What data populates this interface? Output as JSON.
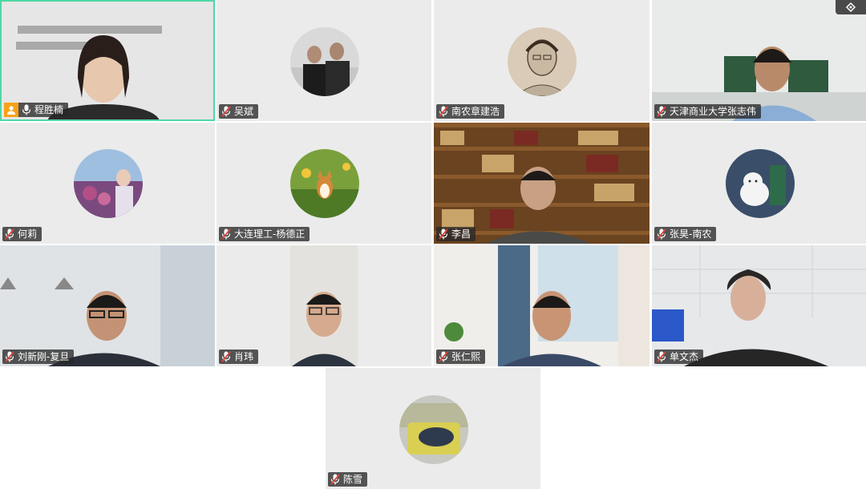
{
  "participants": [
    {
      "name": "程胜楠",
      "video": "camera",
      "active": true,
      "mic": "on"
    },
    {
      "name": "吴斌",
      "video": "avatar",
      "mic": "muted"
    },
    {
      "name": "南农章建浩",
      "video": "avatar",
      "mic": "muted"
    },
    {
      "name": "天津商业大学张志伟",
      "video": "camera",
      "mic": "muted"
    },
    {
      "name": "何莉",
      "video": "avatar",
      "mic": "muted"
    },
    {
      "name": "大连理工-杨德正",
      "video": "avatar",
      "mic": "muted"
    },
    {
      "name": "李昌",
      "video": "camera",
      "mic": "muted"
    },
    {
      "name": "张昊-南农",
      "video": "avatar",
      "mic": "muted"
    },
    {
      "name": "刘新刚-复旦",
      "video": "camera",
      "mic": "muted"
    },
    {
      "name": "肖玮",
      "video": "camera",
      "mic": "muted"
    },
    {
      "name": "张仁熙",
      "video": "camera",
      "mic": "muted"
    },
    {
      "name": "单文杰",
      "video": "camera",
      "mic": "muted"
    },
    {
      "name": "陈雪",
      "video": "avatar",
      "mic": "muted"
    }
  ],
  "colors": {
    "active_border": "#4ed8a4",
    "muted_icon": "#e0443a",
    "user_badge": "#f7a11a"
  }
}
